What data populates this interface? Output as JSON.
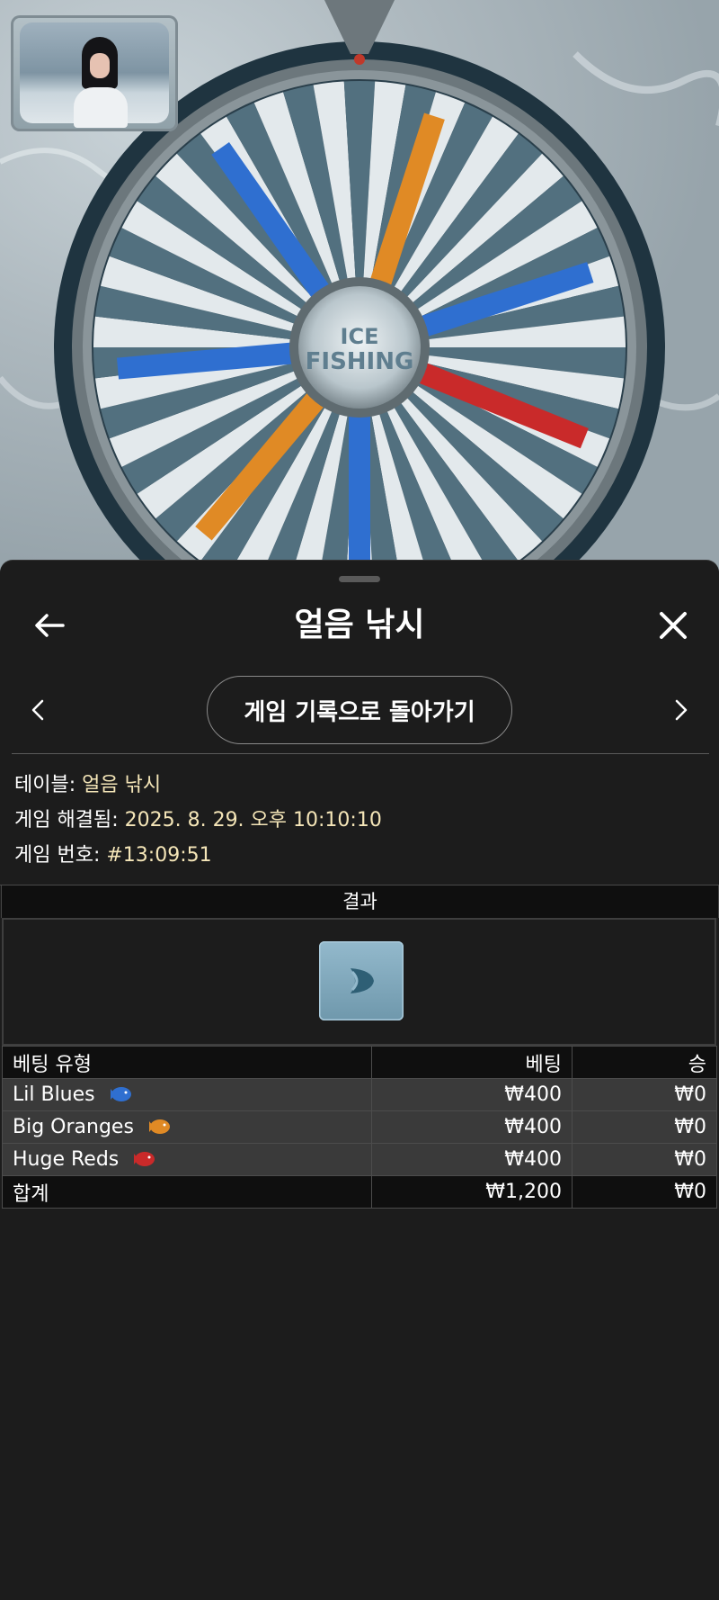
{
  "wheel": {
    "center_text_1": "ICE",
    "center_text_2": "FISHING",
    "labels": [
      "LIL' BLUES",
      "BIG ORANGES",
      "LIL' BLUES",
      "LIL' BLUES",
      "HUGE REDS",
      "LIL' BLUES",
      "BIG ORANGES"
    ]
  },
  "header": {
    "title": "얼음 낚시"
  },
  "nav": {
    "back_to_history": "게임 기록으로 돌아가기"
  },
  "info": {
    "table_label": "테이블:",
    "table_value": "얼음 낚시",
    "resolved_label": "게임 해결됨:",
    "resolved_value": "2025. 8. 29. 오후 10:10:10",
    "number_label": "게임 번호:",
    "number_value": "#13:09:51"
  },
  "result": {
    "header": "결과"
  },
  "bets": {
    "col_type": "베팅 유형",
    "col_bet": "베팅",
    "col_win": "승",
    "rows": [
      {
        "type": "Lil Blues",
        "bet": "₩400",
        "win": "₩0",
        "icon": "blue-fish-icon"
      },
      {
        "type": "Big Oranges",
        "bet": "₩400",
        "win": "₩0",
        "icon": "orange-fish-icon"
      },
      {
        "type": "Huge Reds",
        "bet": "₩400",
        "win": "₩0",
        "icon": "red-fish-icon"
      }
    ],
    "total": {
      "label": "합계",
      "bet": "₩1,200",
      "win": "₩0"
    }
  },
  "colors": {
    "panel_bg": "#1c1c1c",
    "value_text": "#f5e6b8",
    "lil_blues": "#2f6fd0",
    "big_oranges": "#e08a25",
    "huge_reds": "#c92a2a"
  }
}
